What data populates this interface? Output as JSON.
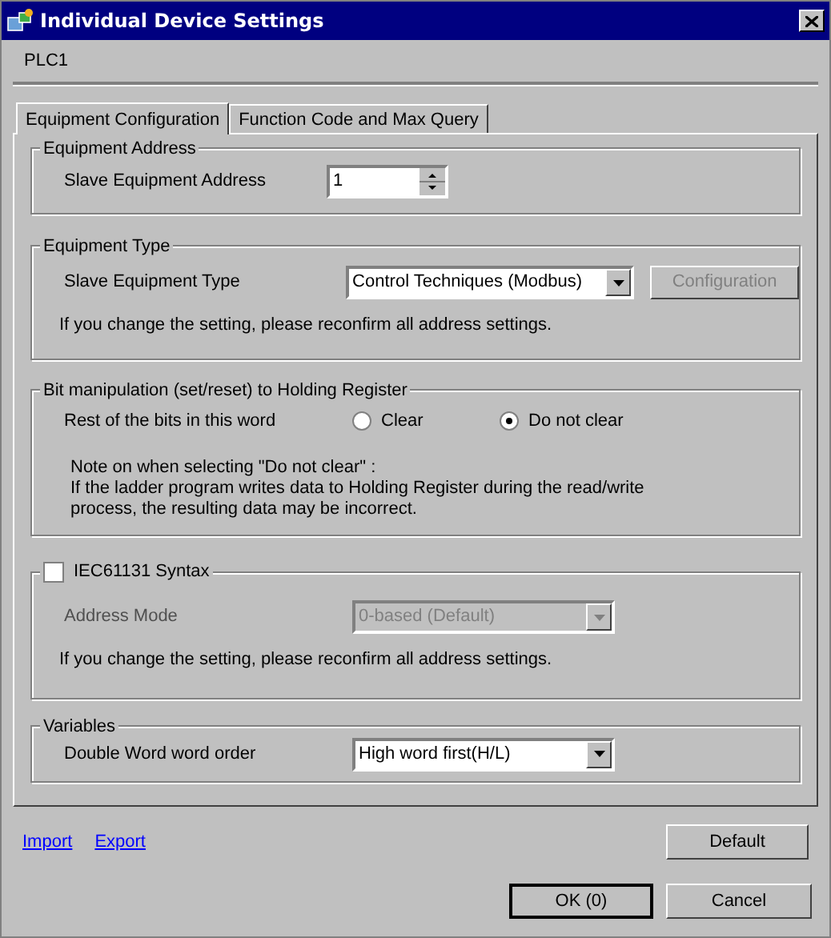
{
  "window": {
    "title": "Individual Device Settings"
  },
  "device": "PLC1",
  "tabs": [
    {
      "label": "Equipment Configuration",
      "selected": true
    },
    {
      "label": "Function Code and Max Query",
      "selected": false
    }
  ],
  "equipment_address": {
    "title": "Equipment Address",
    "label": "Slave Equipment Address",
    "value": "1"
  },
  "equipment_type": {
    "title": "Equipment Type",
    "label": "Slave Equipment Type",
    "value": "Control Techniques (Modbus)",
    "button": {
      "label": "Configuration",
      "disabled": true
    },
    "note": "If you change the setting, please reconfirm all address settings."
  },
  "bit_manipulation": {
    "title": "Bit manipulation (set/reset) to Holding Register",
    "label": "Rest of the bits in this word",
    "options": [
      {
        "label": "Clear",
        "selected": false
      },
      {
        "label": "Do not clear",
        "selected": true
      }
    ],
    "note": [
      "Note on when selecting \"Do not clear\" :",
      "If the ladder program writes data to Holding Register during the read/write",
      "process, the resulting data may be incorrect."
    ]
  },
  "iec61131": {
    "title": "IEC61131 Syntax",
    "checked": false,
    "label": "Address Mode",
    "value": "0-based (Default)",
    "disabled": true,
    "note": "If you change the setting, please reconfirm all address settings."
  },
  "variables": {
    "title": "Variables",
    "label": "Double Word word order",
    "value": "High word first(H/L)"
  },
  "links": [
    "Import",
    "Export"
  ],
  "buttons": {
    "default": "Default",
    "ok": "OK (0)",
    "cancel": "Cancel"
  }
}
